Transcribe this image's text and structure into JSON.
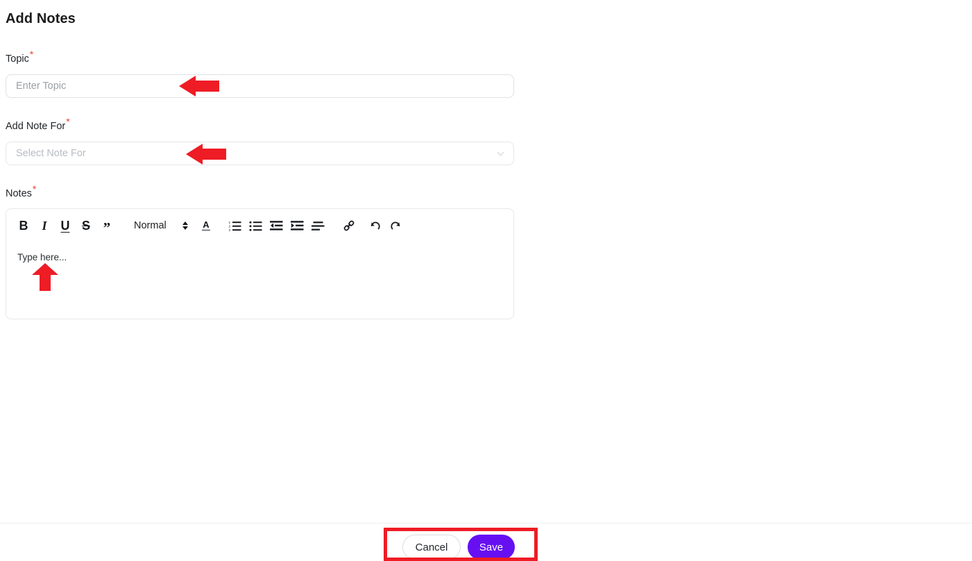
{
  "page": {
    "title": "Add Notes"
  },
  "fields": {
    "topic": {
      "label": "Topic",
      "required_marker": "*",
      "placeholder": "Enter Topic",
      "value": ""
    },
    "note_for": {
      "label": "Add Note For",
      "required_marker": "*",
      "placeholder": "Select Note For",
      "value": "",
      "chevron_icon": "chevron-down-icon"
    },
    "notes": {
      "label": "Notes",
      "required_marker": "*",
      "placeholder": "Type here...",
      "value": ""
    }
  },
  "editor_toolbar": {
    "bold": {
      "label": "B",
      "icon": "bold-icon"
    },
    "italic": {
      "label": "I",
      "icon": "italic-icon"
    },
    "underline": {
      "label": "U",
      "icon": "underline-icon"
    },
    "strikethrough": {
      "label": "S",
      "icon": "strikethrough-icon"
    },
    "blockquote": {
      "label": "”",
      "icon": "blockquote-icon"
    },
    "format": {
      "label": "Normal",
      "icon": "format-stepper-icon"
    },
    "text_color": {
      "label": "A",
      "icon": "text-color-icon"
    },
    "ordered_list": {
      "icon": "ordered-list-icon"
    },
    "bullet_list": {
      "icon": "bullet-list-icon"
    },
    "outdent": {
      "icon": "outdent-icon"
    },
    "indent": {
      "icon": "indent-icon"
    },
    "align": {
      "icon": "align-icon"
    },
    "link": {
      "icon": "link-icon"
    },
    "undo": {
      "icon": "undo-icon"
    },
    "redo": {
      "icon": "redo-icon"
    }
  },
  "footer": {
    "cancel_label": "Cancel",
    "save_label": "Save"
  },
  "colors": {
    "save_button": "#6610f2",
    "annotation_red": "#ee1c25",
    "required_star": "#e8442c",
    "placeholder_text": "#9aa0a6"
  },
  "annotations": {
    "arrow_topic": "left-arrow-annotation",
    "arrow_note_for": "left-arrow-annotation",
    "arrow_notes": "up-arrow-annotation",
    "box_footer_actions": "highlight-box-annotation"
  }
}
